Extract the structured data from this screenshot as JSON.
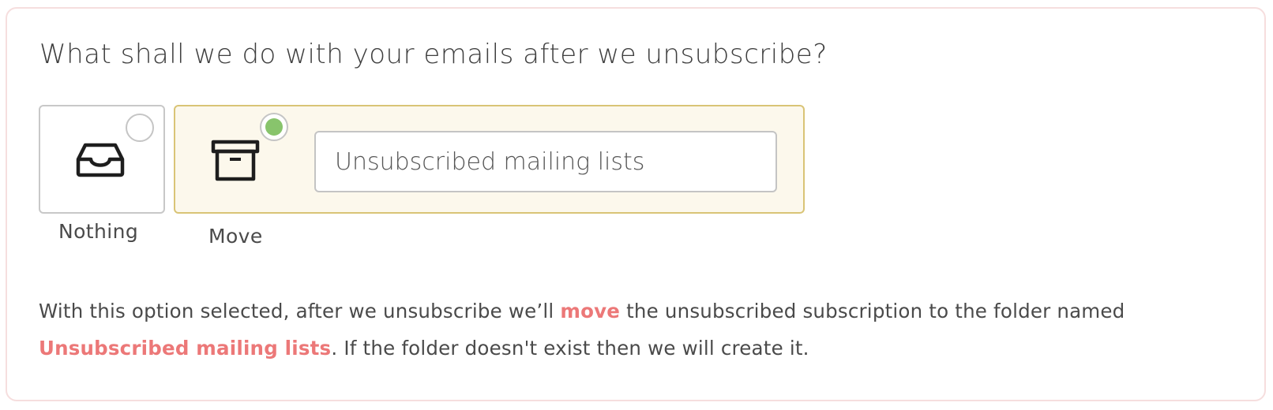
{
  "question": "What shall we do with your emails after we unsubscribe?",
  "options": [
    {
      "label": "Nothing",
      "icon": "inbox-tray-icon",
      "selected": false
    },
    {
      "label": "Move",
      "icon": "archive-box-icon",
      "selected": true,
      "folder_name_value": "Unsubscribed mailing lists"
    }
  ],
  "description": {
    "part1": "With this option selected, after we unsubscribe we’ll ",
    "highlight_action": "move",
    "part2": " the unsubscribed subscription to the folder named ",
    "highlight_folder": "Unsubscribed mailing lists",
    "part3": ". If the folder doesn't exist then we will create it."
  },
  "colors": {
    "accent": "#ec7878",
    "selected_tile_border": "#d9c476",
    "selected_tile_bg": "#fcf8ec",
    "radio_selected": "#88c46c",
    "panel_border": "#f6dede"
  }
}
